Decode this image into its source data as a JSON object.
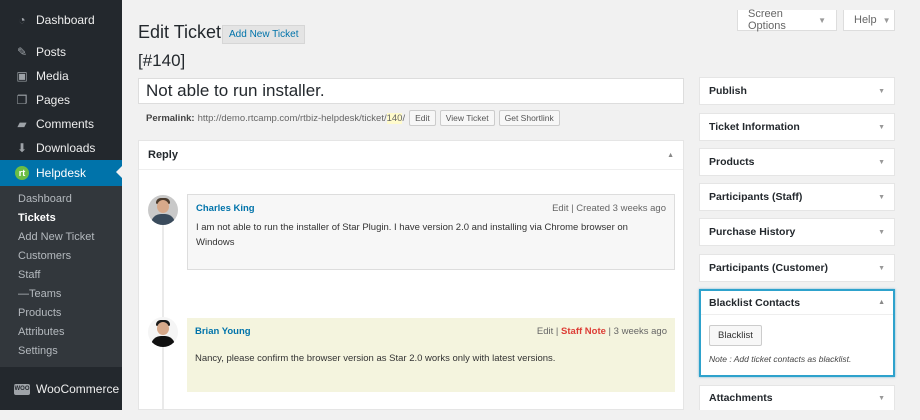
{
  "sidebar": {
    "menu": [
      {
        "label": "Dashboard",
        "icon": "dashboard-icon"
      },
      {
        "label": "Posts",
        "icon": "pin-icon"
      },
      {
        "label": "Media",
        "icon": "media-icon"
      },
      {
        "label": "Pages",
        "icon": "pages-icon"
      },
      {
        "label": "Comments",
        "icon": "comments-icon"
      },
      {
        "label": "Downloads",
        "icon": "download-icon"
      },
      {
        "label": "Helpdesk",
        "icon": "helpdesk-icon",
        "badge": "rt"
      }
    ],
    "submenu": [
      "Dashboard",
      "Tickets",
      "Add New Ticket",
      "Customers",
      "Staff",
      "—Teams",
      "Products",
      "Attributes",
      "Settings"
    ],
    "woocommerce": {
      "label": "WooCommerce",
      "badge": "WOO"
    }
  },
  "top": {
    "screen_options": "Screen Options",
    "help": "Help"
  },
  "header": {
    "title": "Edit Ticket",
    "add_new": "Add New Ticket",
    "ticket_number": "[#140]"
  },
  "ticket": {
    "title_value": "Not able to run installer.",
    "permalink": {
      "label": "Permalink:",
      "base": "http://demo.rtcamp.com/rtbiz-helpdesk/ticket/",
      "slug": "140",
      "trail": "/",
      "edit": "Edit",
      "view": "View Ticket",
      "shortlink": "Get Shortlink"
    }
  },
  "reply": {
    "title": "Reply",
    "entries": [
      {
        "author": "Charles King",
        "edit": "Edit",
        "sep": "|",
        "created": "Created 3 weeks ago",
        "message": "I am not able to run the installer of Star Plugin. I have version 2.0 and installing via Chrome browser on Windows"
      },
      {
        "author": "Brian Young",
        "edit": "Edit",
        "sep": "|",
        "staff_note": "Staff Note",
        "sep2": "|",
        "time": "3 weeks ago",
        "message": "Nancy, please confirm the browser version as Star 2.0 works only with latest versions."
      }
    ]
  },
  "metaboxes": [
    "Publish",
    "Ticket Information",
    "Products",
    "Participants (Staff)",
    "Purchase History",
    "Participants (Customer)"
  ],
  "blacklist": {
    "title": "Blacklist Contacts",
    "button": "Blacklist",
    "note": "Note : Add ticket contacts as blacklist."
  },
  "attachments": {
    "title": "Attachments"
  },
  "colors": {
    "sidebar_bg": "#23282d",
    "active": "#0073aa",
    "link": "#0073aa",
    "staff_note": "#dd3d36",
    "highlight_border": "#2ea2cc"
  }
}
